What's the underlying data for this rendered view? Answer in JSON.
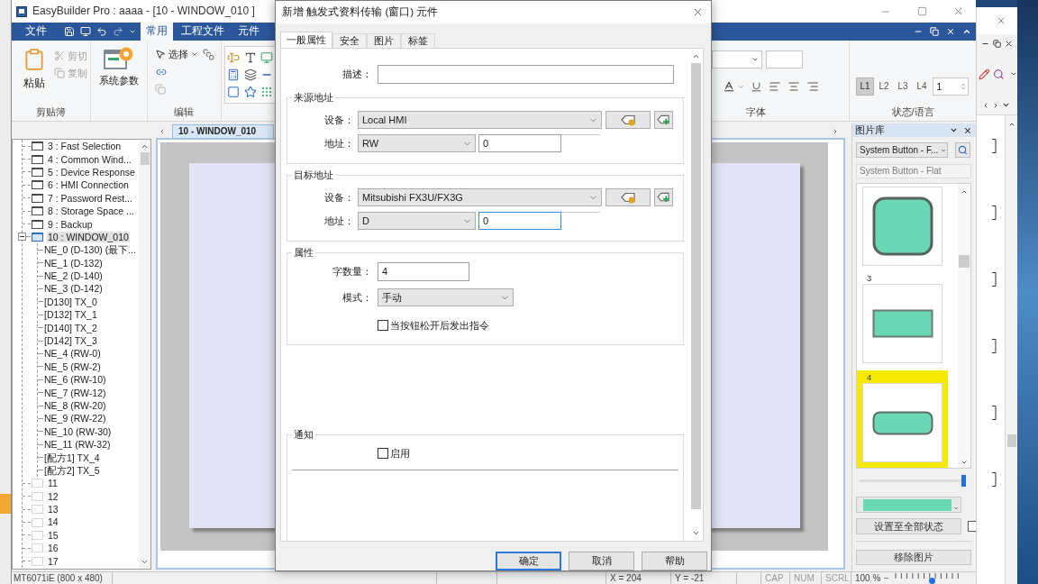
{
  "main_window": {
    "title": "EasyBuilder Pro : aaaa - [10 - WINDOW_010 ]"
  },
  "ribbon": {
    "file_tab": "文件",
    "tabs": [
      {
        "label": "常用",
        "selected": true
      },
      {
        "label": "工程文件",
        "selected": false
      },
      {
        "label": "元件",
        "selected": false
      }
    ],
    "clipboard": {
      "paste": "粘贴",
      "cut": {
        "label": "剪切",
        "disabled": true
      },
      "copy": {
        "label": "复制",
        "disabled": true
      },
      "group_label": "剪贴簿"
    },
    "system_parameters": "系统参数",
    "edit": {
      "select": "选择",
      "group_label": "编辑"
    },
    "font": {
      "group_label": "字体"
    },
    "states": {
      "buttons": [
        {
          "label": "L1",
          "selected": true
        },
        {
          "label": "L2",
          "selected": false
        },
        {
          "label": "L3",
          "selected": false
        },
        {
          "label": "L4",
          "selected": false
        }
      ],
      "value": "1",
      "group_label": "状态/语言"
    }
  },
  "tree": {
    "items": [
      {
        "label": "3 : Fast Selection",
        "kind": "window",
        "selected": false
      },
      {
        "label": "4 : Common Wind...",
        "kind": "window",
        "selected": false
      },
      {
        "label": "5 : Device Response",
        "kind": "window",
        "selected": false
      },
      {
        "label": "6 : HMI Connection",
        "kind": "window",
        "selected": false
      },
      {
        "label": "7 : Password Rest...",
        "kind": "window",
        "selected": false
      },
      {
        "label": "8 : Storage Space ...",
        "kind": "window",
        "selected": false
      },
      {
        "label": "9 : Backup",
        "kind": "window",
        "selected": false
      },
      {
        "label": "10 : WINDOW_010",
        "kind": "window",
        "selected": true,
        "expanded": true,
        "children": [
          {
            "label": "NE_0 (D-130) (最下...",
            "selected": false
          },
          {
            "label": "NE_1 (D-132)",
            "selected": false
          },
          {
            "label": "NE_2 (D-140)",
            "selected": false
          },
          {
            "label": "NE_3 (D-142)",
            "selected": false
          },
          {
            "label": "[D130] TX_0",
            "selected": false
          },
          {
            "label": "[D132] TX_1",
            "selected": false
          },
          {
            "label": "[D140] TX_2",
            "selected": false
          },
          {
            "label": "[D142] TX_3",
            "selected": false
          },
          {
            "label": "NE_4 (RW-0)",
            "selected": false
          },
          {
            "label": "NE_5 (RW-2)",
            "selected": false
          },
          {
            "label": "NE_6 (RW-10)",
            "selected": false
          },
          {
            "label": "NE_7 (RW-12)",
            "selected": false
          },
          {
            "label": "NE_8 (RW-20)",
            "selected": false
          },
          {
            "label": "NE_9 (RW-22)",
            "selected": false
          },
          {
            "label": "NE_10 (RW-30)",
            "selected": false
          },
          {
            "label": "NE_11 (RW-32)",
            "selected": false
          },
          {
            "label": "[配方1] TX_4",
            "selected": false
          },
          {
            "label": "[配方2] TX_5",
            "selected": false
          }
        ]
      },
      {
        "label": "11",
        "kind": "empty",
        "selected": false
      },
      {
        "label": "12",
        "kind": "empty",
        "selected": false
      },
      {
        "label": "13",
        "kind": "empty",
        "selected": false
      },
      {
        "label": "14",
        "kind": "empty",
        "selected": false
      },
      {
        "label": "15",
        "kind": "empty",
        "selected": false
      },
      {
        "label": "16",
        "kind": "empty",
        "selected": false
      },
      {
        "label": "17",
        "kind": "empty",
        "selected": false
      }
    ]
  },
  "document_tab": "10 - WINDOW_010",
  "gallery": {
    "title": "图片库",
    "library": "System Button - F...",
    "library_name": "System Button - Flat",
    "items": [
      {
        "kind": "square",
        "selected": false
      },
      {
        "label": "3",
        "kind": "rectangle",
        "selected": false
      },
      {
        "label": "4",
        "kind": "pill",
        "selected": true
      }
    ],
    "slider": {
      "level": 1
    },
    "apply_all": "设置至全部状态",
    "apply_all_checked": false,
    "remove": "移除图片"
  },
  "status_bar": {
    "model": "MT6071iE (800 x 480)",
    "x": "X = 204",
    "y": "Y = -21",
    "caps": "CAP",
    "num": "NUM",
    "scroll": "SCRL",
    "zoom": "100 %",
    "zoom_slider": {
      "level": 0.57
    }
  },
  "dialog": {
    "title": "新增 触发式资料传输 (窗口) 元件",
    "tabs": [
      {
        "label": "一般属性",
        "selected": true
      },
      {
        "label": "安全",
        "selected": false
      },
      {
        "label": "图片",
        "selected": false
      },
      {
        "label": "标签",
        "selected": false
      }
    ],
    "description_label": "描述：",
    "source": {
      "legend": "来源地址",
      "device_label": "设备：",
      "device": "Local HMI",
      "address_label": "地址：",
      "address_type": "RW",
      "address": "0",
      "focused": false
    },
    "target": {
      "legend": "目标地址",
      "device_label": "设备：",
      "device": "Mitsubishi FX3U/FX3G",
      "address_label": "地址：",
      "address_type": "D",
      "address": "0",
      "focused": true
    },
    "attributes": {
      "legend": "属性",
      "word_count_label": "字数量：",
      "word_count": "4",
      "mode_label": "模式：",
      "mode": "手动",
      "release_option": {
        "label": "当按钮松开后发出指令",
        "checked": false
      }
    },
    "notification": {
      "legend": "通知",
      "enable": {
        "label": "启用",
        "checked": false
      }
    },
    "buttons": [
      {
        "label": "确定",
        "default": true
      },
      {
        "label": "取消",
        "default": false
      },
      {
        "label": "帮助",
        "default": false
      }
    ]
  }
}
